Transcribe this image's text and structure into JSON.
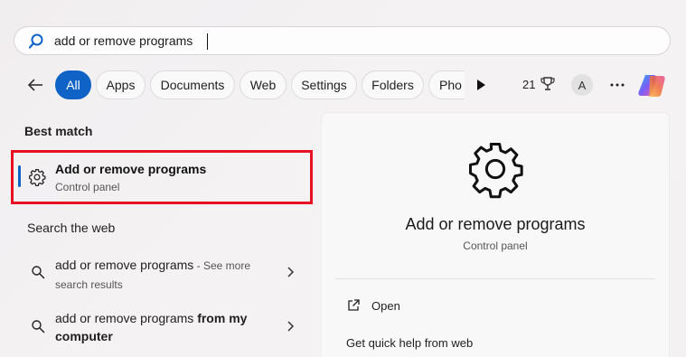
{
  "search": {
    "value": "add or remove programs",
    "icon": "search-icon"
  },
  "filters": {
    "tabs": [
      {
        "label": "All",
        "active": true
      },
      {
        "label": "Apps"
      },
      {
        "label": "Documents"
      },
      {
        "label": "Web"
      },
      {
        "label": "Settings"
      },
      {
        "label": "Folders"
      },
      {
        "label": "Pho"
      }
    ],
    "points": "21",
    "avatar_initial": "A"
  },
  "best_match": {
    "section_label": "Best match",
    "title": "Add or remove programs",
    "subtitle": "Control panel"
  },
  "web": {
    "section_label": "Search the web",
    "items": [
      {
        "query": "add or remove programs",
        "suffix": " - See more",
        "suffix2": "search results"
      },
      {
        "query": "add or remove programs ",
        "bold": "from my",
        "line2": "computer"
      }
    ]
  },
  "preview": {
    "title": "Add or remove programs",
    "subtitle": "Control panel",
    "actions": [
      {
        "label": "Open"
      }
    ],
    "help_label": "Get quick help from web"
  },
  "colors": {
    "accent": "#0f62c6",
    "highlight": "#e81123"
  }
}
